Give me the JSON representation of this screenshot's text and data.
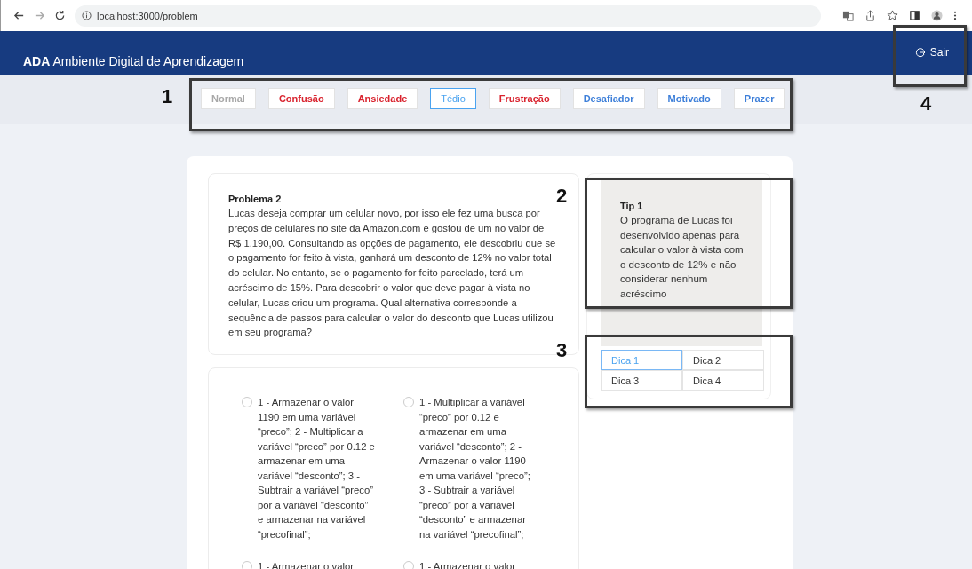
{
  "browser": {
    "url": "localhost:3000/problem"
  },
  "header": {
    "brand": "ADA",
    "title": "Ambiente Digital de Aprendizagem",
    "logout": "Sair"
  },
  "emotions": [
    {
      "label": "Normal",
      "color": "#a8a8a8",
      "selected": false
    },
    {
      "label": "Confusão",
      "color": "#d9232e",
      "selected": false
    },
    {
      "label": "Ansiedade",
      "color": "#d9232e",
      "selected": false
    },
    {
      "label": "Tédio",
      "color": "#4aa3f0",
      "selected": true
    },
    {
      "label": "Frustração",
      "color": "#d9232e",
      "selected": false
    },
    {
      "label": "Desafiador",
      "color": "#3d7fd9",
      "selected": false
    },
    {
      "label": "Motivado",
      "color": "#3d7fd9",
      "selected": false
    },
    {
      "label": "Prazer",
      "color": "#3d7fd9",
      "selected": false
    }
  ],
  "problem": {
    "title": "Problema 2",
    "text": "Lucas deseja comprar um celular novo, por isso ele fez uma busca por preços de celulares no site da Amazon.com e gostou de um no valor de R$ 1.190,00. Consultando as opções de pagamento, ele descobriu que se o pagamento for feito à vista, ganhará um desconto de 12% no valor total do celular. No entanto, se o pagamento for feito parcelado, terá um acréscimo de 15%. Para descobrir o valor que deve pagar à vista no celular, Lucas criou um programa. Qual alternativa corresponde a sequência de passos para calcular o valor do desconto que Lucas utilizou em seu programa?"
  },
  "tip": {
    "title": "Tip 1",
    "text": "O programa de Lucas foi desenvolvido apenas para calcular o valor à vista com o desconto de 12% e não considerar nenhum acréscimo"
  },
  "hints": [
    {
      "label": "Dica 1",
      "selected": true
    },
    {
      "label": "Dica 2",
      "selected": false
    },
    {
      "label": "Dica 3",
      "selected": false
    },
    {
      "label": "Dica 4",
      "selected": false
    }
  ],
  "options": [
    {
      "text": "1 - Armazenar o valor 1190 em uma variável “preco”; 2 - Multiplicar a variável “preco” por 0.12 e armazenar em uma variável “desconto”; 3 - Subtrair a variável “preco” por a variável “desconto” e armazenar na variável “precofinal”;",
      "selected": false
    },
    {
      "text": "1 - Multiplicar a variável “preco” por 0.12 e armazenar em uma variável “desconto”; 2 - Armazenar o valor 1190 em uma variável “preco”; 3 - Subtrair a variável “preco” por a variável “desconto” e armazenar na variável “precofinal”;",
      "selected": false
    },
    {
      "text": "1 - Armazenar o valor",
      "selected": false
    },
    {
      "text": "1 - Armazenar o valor",
      "selected": false
    }
  ],
  "annotations": [
    {
      "label": "1"
    },
    {
      "label": "2"
    },
    {
      "label": "3"
    },
    {
      "label": "4"
    }
  ]
}
